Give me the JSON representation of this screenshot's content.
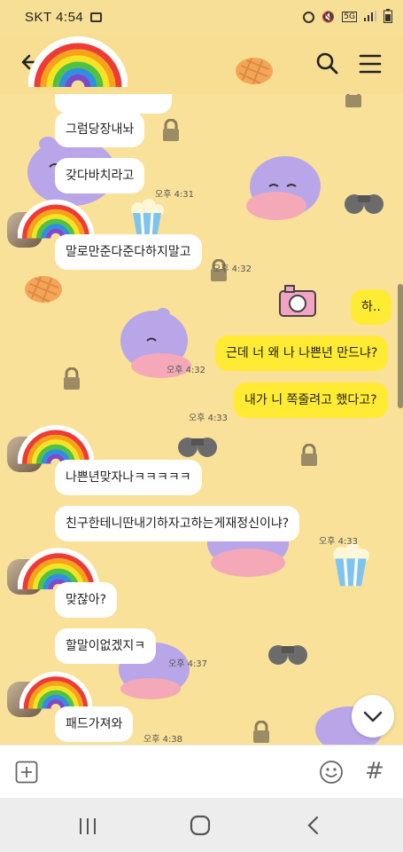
{
  "status": {
    "carrier_time": "SKT 4:54",
    "network": "5G"
  },
  "messages": [
    {
      "id": "m1",
      "text": "그럼당장내놔",
      "side": "in"
    },
    {
      "id": "m2",
      "text": "갖다바치라고",
      "side": "in",
      "time": "오후 4:31"
    },
    {
      "id": "m3",
      "text": "말로만준다준다하지말고",
      "side": "in",
      "time": "오후 4:32"
    },
    {
      "id": "m4",
      "text": "하..",
      "side": "out"
    },
    {
      "id": "m5",
      "text": "근데 너 왜 나 나쁜년 만드냐?",
      "side": "out",
      "time": "오후 4:32"
    },
    {
      "id": "m6",
      "text": "내가 니 쪽줄려고 했다고?",
      "side": "out",
      "time": "오후 4:33"
    },
    {
      "id": "m7",
      "text": "나쁜년맞자나ㅋㅋㅋㅋㅋ",
      "side": "in"
    },
    {
      "id": "m8",
      "text": "친구한테니딴내기하자고하는게재정신이냐?",
      "side": "in",
      "time": "오후 4:33"
    },
    {
      "id": "m9",
      "text": "맞잖아?",
      "side": "in"
    },
    {
      "id": "m10",
      "text": "할말이없겠지ㅋ",
      "side": "in",
      "time": "오후 4:37"
    },
    {
      "id": "m11",
      "text": "패드가져와",
      "side": "in",
      "time": "오후 4:38"
    }
  ],
  "icons": {
    "back": "back-arrow-icon",
    "search": "search-icon",
    "menu": "menu-icon",
    "plus": "plus-icon",
    "emoji": "emoji-icon",
    "hash": "#",
    "scroll_down": "chevron-down-icon"
  },
  "colors": {
    "background": "#f9e19a",
    "incoming_bubble": "#ffffff",
    "outgoing_bubble": "#ffeb33",
    "header": "#f7de92"
  }
}
